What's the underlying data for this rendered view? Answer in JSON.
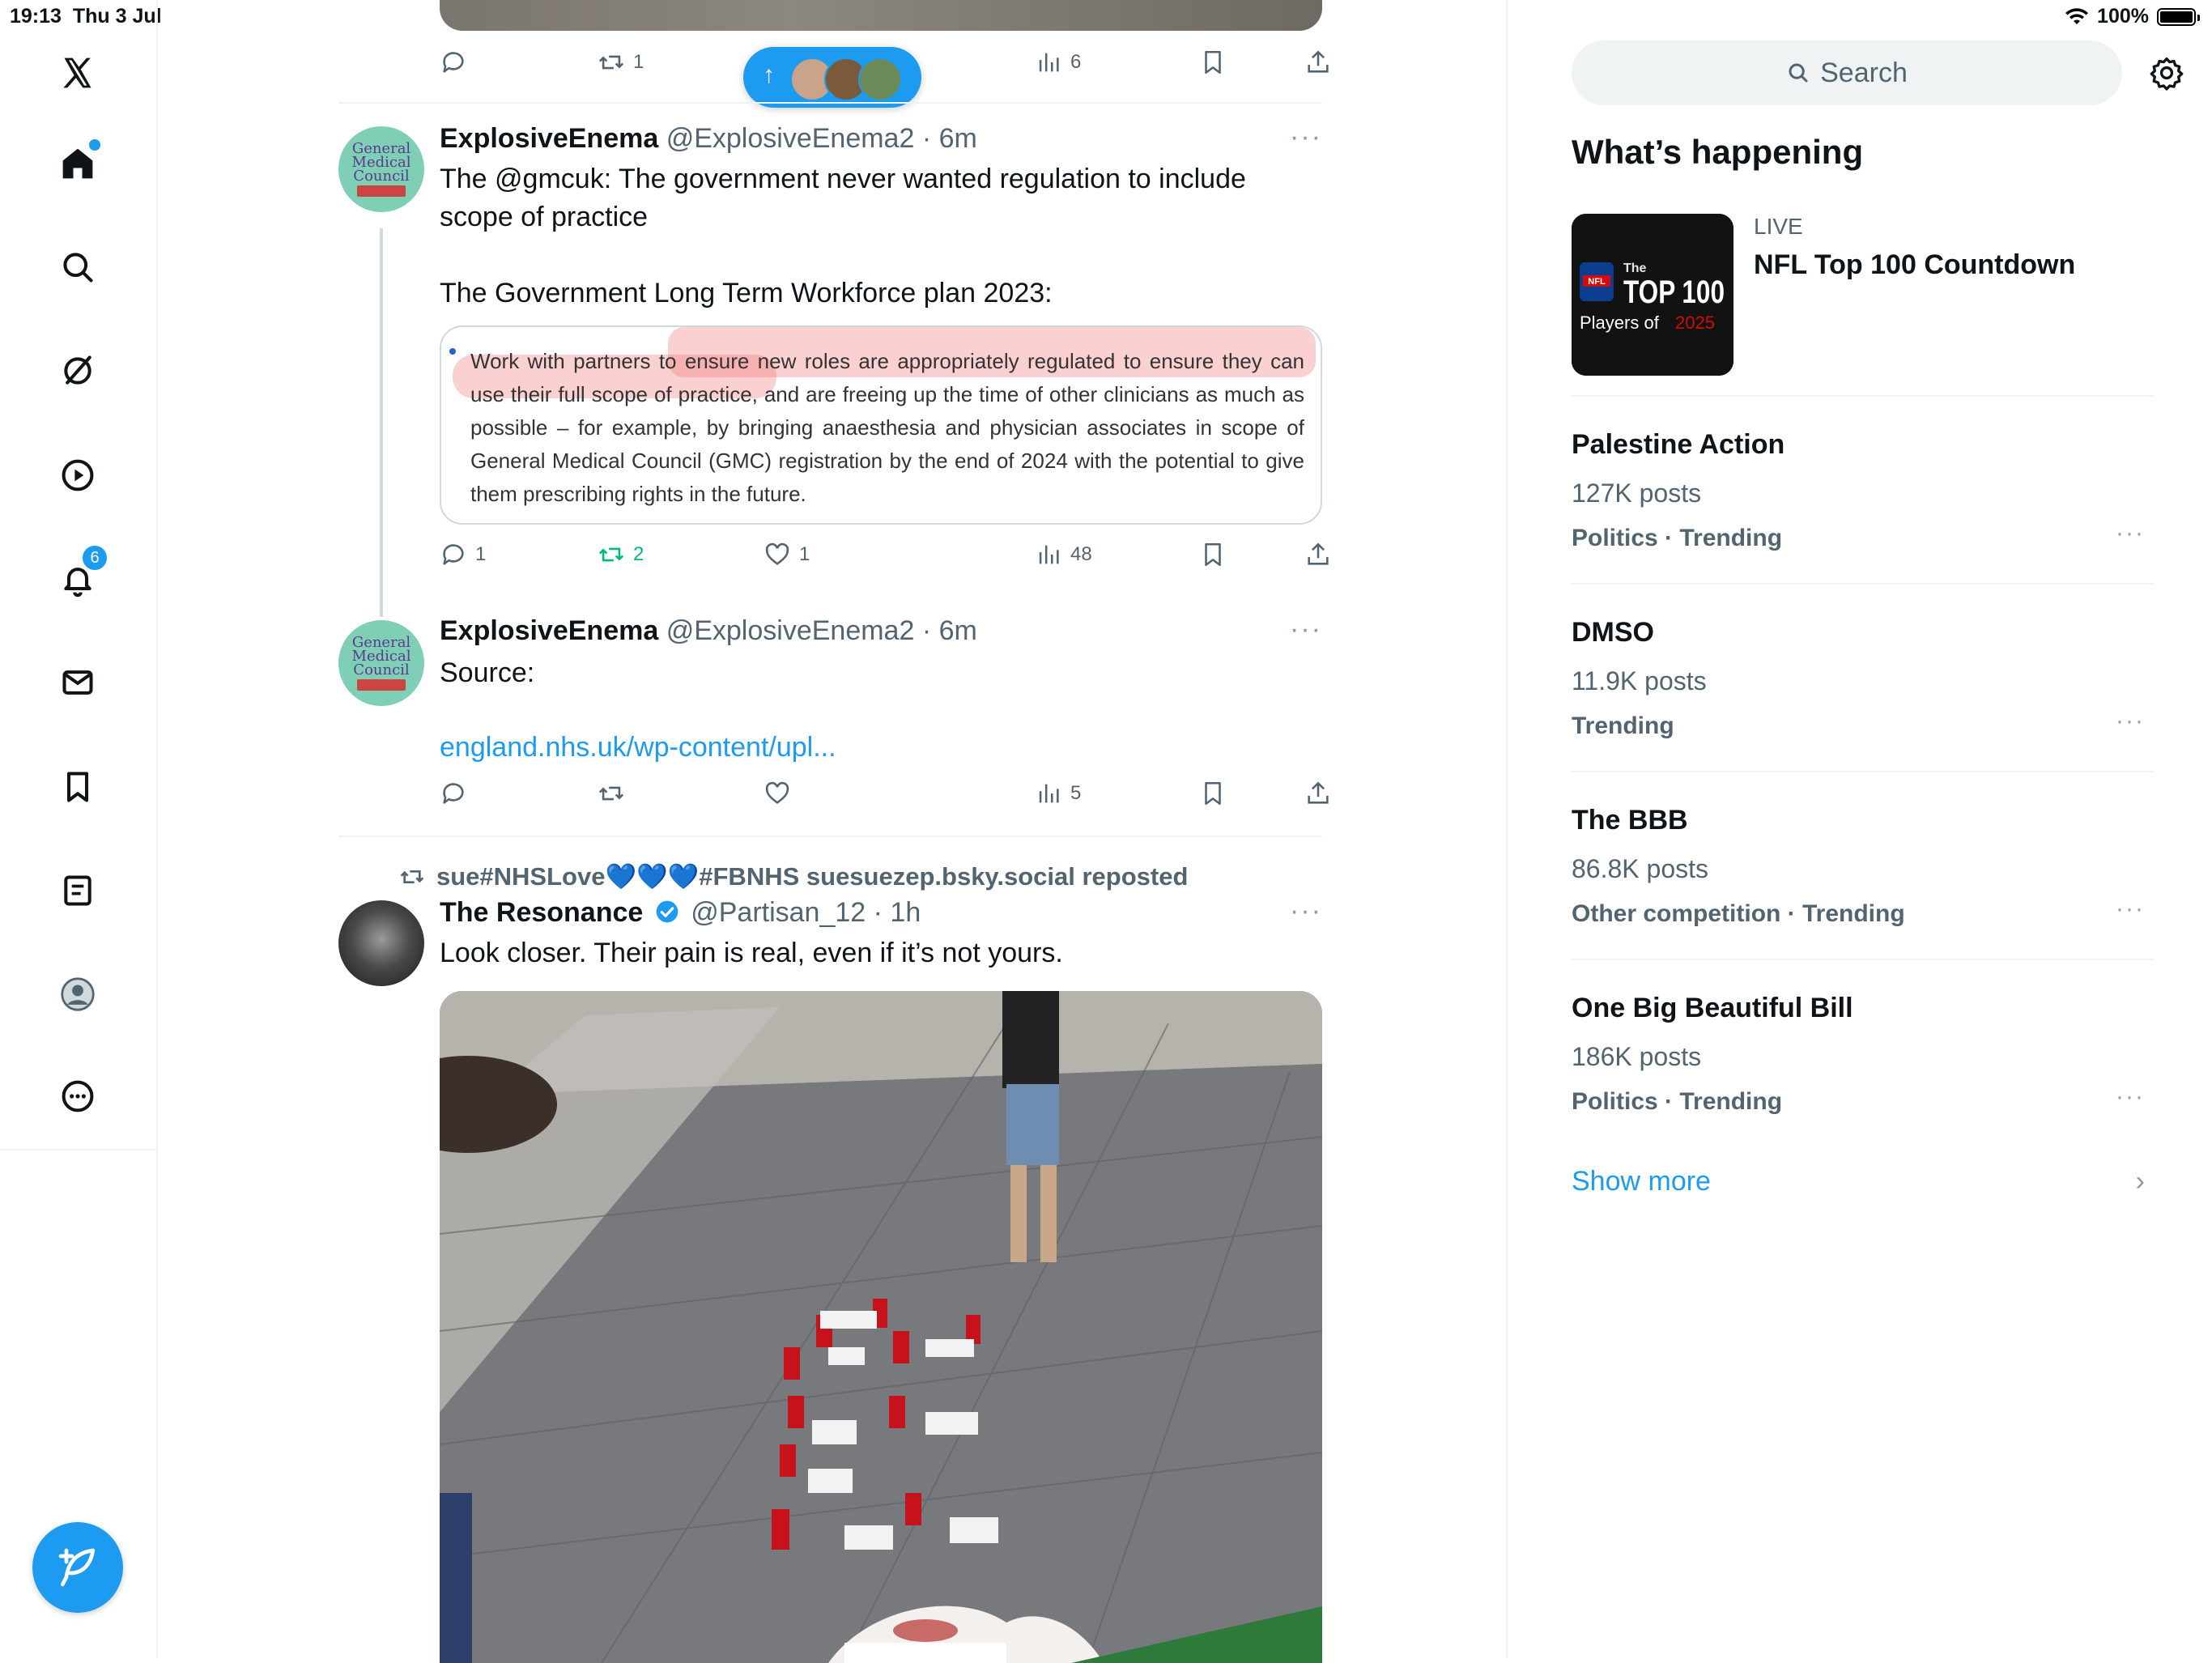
{
  "status": {
    "time": "19:13",
    "date": "Thu 3 Jul",
    "battery": "100%"
  },
  "nav": {
    "notifications_badge": "6"
  },
  "feed": {
    "new_posts_button": "↑",
    "top_actions": {
      "retweets": "1",
      "views": "6"
    },
    "tweet1": {
      "name": "ExplosiveEnema",
      "handle": "@ExplosiveEnema2 · 6m",
      "text_line1": "The @gmcuk: The government never wanted regulation to include",
      "text_line2": "scope of practice",
      "text_line3": "The Government Long Term Workforce plan 2023:",
      "doc_text": "Work with partners to ensure new roles are appropriately regulated to ensure they can use their full scope of practice, and are freeing up the time of other clinicians as much as possible – for example, by bringing anaesthesia and physician associates in scope of General Medical Council (GMC) registration by the end of 2024 with the potential to give them prescribing rights in the future.",
      "replies": "1",
      "retweets": "2",
      "likes": "1",
      "views": "48"
    },
    "tweet2": {
      "name": "ExplosiveEnema",
      "handle": "@ExplosiveEnema2 · 6m",
      "text": "Source:",
      "link": "england.nhs.uk/wp-content/upl...",
      "views": "5"
    },
    "tweet3": {
      "reposted_by": "sue#NHSLove💙💙💙#FBNHS suesuezep.bsky.social reposted",
      "name": "The Resonance",
      "handle": "@Partisan_12 · 1h",
      "text": "Look closer. Their pain is real, even if it’s not yours."
    },
    "gmc_avatar_text": [
      "General",
      "Medical",
      "Council"
    ]
  },
  "sidebar": {
    "search_placeholder": "Search",
    "heading": "What’s happening",
    "live": {
      "label": "LIVE",
      "title": "NFL Top 100 Countdown",
      "thumb_top": "The",
      "thumb_big": "TOP 100",
      "thumb_sub": "Players of",
      "thumb_year": "2025",
      "thumb_logo": "NFL"
    },
    "trends": [
      {
        "title": "Palestine Action",
        "count": "127K posts",
        "meta": "Politics · Trending"
      },
      {
        "title": "DMSO",
        "count": "11.9K posts",
        "meta": "Trending"
      },
      {
        "title": "The BBB",
        "count": "86.8K posts",
        "meta": "Other competition · Trending"
      },
      {
        "title": "One Big Beautiful Bill",
        "count": "186K posts",
        "meta": "Politics · Trending"
      }
    ],
    "show_more": "Show more"
  },
  "colors": {
    "accent": "#1d9bf0",
    "repost_green": "#00ba7c",
    "secondary_text": "#536471"
  }
}
